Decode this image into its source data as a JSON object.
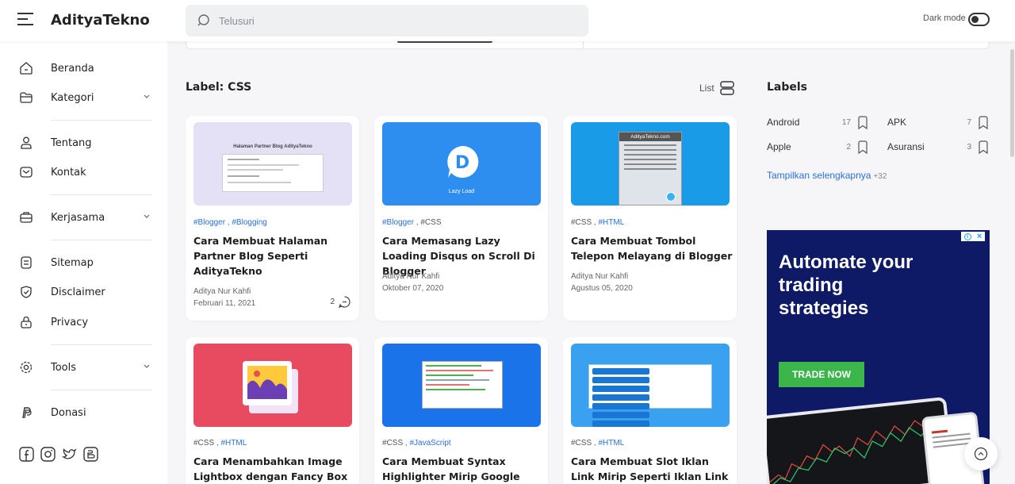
{
  "header": {
    "brand": "AdityaTekno",
    "search_placeholder": "Telusuri",
    "dark_mode_label": "Dark mode"
  },
  "sidebar": {
    "items": [
      {
        "label": "Beranda",
        "icon": "home-icon"
      },
      {
        "label": "Kategori",
        "icon": "folder-icon"
      },
      {
        "label": "Tentang",
        "icon": "user-icon"
      },
      {
        "label": "Kontak",
        "icon": "mail-icon"
      },
      {
        "label": "Kerjasama",
        "icon": "briefcase-icon"
      },
      {
        "label": "Sitemap",
        "icon": "document-icon"
      },
      {
        "label": "Disclaimer",
        "icon": "shield-icon"
      },
      {
        "label": "Privacy",
        "icon": "lock-icon"
      },
      {
        "label": "Tools",
        "icon": "gear-icon"
      },
      {
        "label": "Donasi",
        "icon": "paypal-icon"
      }
    ],
    "social": [
      "facebook-icon",
      "instagram-icon",
      "twitter-icon",
      "blogger-icon"
    ]
  },
  "main": {
    "label_title": "Label: CSS",
    "view_label": "List",
    "posts": [
      {
        "tags": [
          "#Blogger",
          "#Blogging"
        ],
        "title": "Cara Membuat Halaman Partner Blog Seperti AdityaTekno",
        "author": "Aditya Nur Kahfi",
        "date": "Februari 11, 2021",
        "comments": "2",
        "thumb_text": "Halaman Partner Blog AdityaTekno"
      },
      {
        "tags": [
          "#Blogger",
          "#CSS"
        ],
        "title": "Cara Memasang Lazy Loading Disqus on Scroll Di Blogger",
        "author": "Aditya Nur Kahfi",
        "date": "Oktober 07, 2020",
        "thumb_text": "Lazy Load"
      },
      {
        "tags": [
          "#CSS",
          "#HTML"
        ],
        "title": "Cara Membuat Tombol Telepon Melayang di Blogger",
        "author": "Aditya Nur Kahfi",
        "date": "Agustus 05, 2020",
        "thumb_text": "AdityaTekno.com"
      },
      {
        "tags": [
          "#CSS",
          "#HTML"
        ],
        "title": "Cara Menambahkan Image Lightbox dengan Fancy Box di"
      },
      {
        "tags": [
          "#CSS",
          "#JavaScript"
        ],
        "title": "Cara Membuat Syntax Highlighter Mirip Google Code di"
      },
      {
        "tags": [
          "#CSS",
          "#HTML"
        ],
        "title": "Cara Membuat Slot Iklan Link Mirip Seperti Iklan Link AdSense"
      }
    ]
  },
  "widget": {
    "title": "Labels",
    "labels": [
      {
        "name": "Android",
        "count": "17"
      },
      {
        "name": "APK",
        "count": "7"
      },
      {
        "name": "Apple",
        "count": "2"
      },
      {
        "name": "Asuransi",
        "count": "3"
      }
    ],
    "more_label": "Tampilkan selengkapnya",
    "more_count": "+32"
  },
  "ad": {
    "headline": "Automate your trading strategies",
    "cta": "TRADE NOW"
  },
  "colors": {
    "accent": "#2a6fdb",
    "ad_bg": "#0e1a66",
    "ad_cta": "#3cb54a"
  }
}
